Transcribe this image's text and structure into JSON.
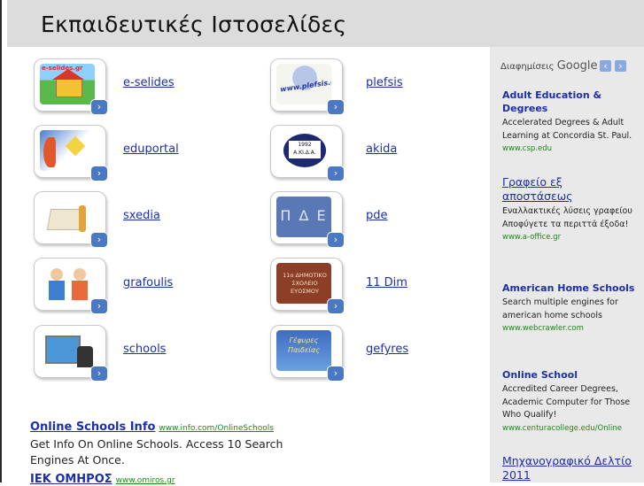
{
  "header": {
    "title": "Εκπαιδευτικές Ιστοσελίδες"
  },
  "sites": [
    {
      "label": "e-selides",
      "thumb_text": "e-selides.gr"
    },
    {
      "label": "plefsis",
      "thumb_text": "www.plefsis.gr"
    },
    {
      "label": "eduportal",
      "thumb_text": ""
    },
    {
      "label": "akida",
      "thumb_text": "1992 Α.ΚΙ.Δ.Α."
    },
    {
      "label": "sxedia",
      "thumb_text": ""
    },
    {
      "label": "pde",
      "thumb_text": "Π Δ Ε"
    },
    {
      "label": "grafoulis",
      "thumb_text": ""
    },
    {
      "label": "11 Dim",
      "thumb_text": "11ο ΔΗΜΟΤΙΚΟ ΣΧΟΛΕΙΟ ΕΥΟΣΜΟΥ"
    },
    {
      "label": "schools",
      "thumb_text": ""
    },
    {
      "label": "gefyres",
      "thumb_text": "Γέφυρες Παιδείας"
    }
  ],
  "main_ads": [
    {
      "title": "Online Schools Info",
      "url": "www.info.com/OnlineSchools",
      "desc": "Get Info On Online Schools. Access 10 Search Engines At Once."
    },
    {
      "title": "ΙΕΚ ΟΜΗΡΟΣ",
      "url": "www.omiros.gr",
      "desc": ""
    }
  ],
  "sidebar": {
    "ads_label": "Διαφημίσεις",
    "google_label": "Google",
    "prev_icon": "chevron-left-icon",
    "next_icon": "chevron-right-icon",
    "ads": [
      {
        "title": "Adult Education & Degrees",
        "desc": "Accelerated Degrees & Adult Learning at Concordia St. Paul.",
        "url": "www.csp.edu"
      },
      {
        "title": "Γραφείο εξ αποστάσεως",
        "desc": "Εναλλακτικές λύσεις γραφείου Αποφύγετε τα περιττά έξοδα!",
        "url": "www.a-office.gr"
      },
      {
        "title": "American Home Schools",
        "desc": "Search multiple engines for american home schools",
        "url": "www.webcrawler.com"
      },
      {
        "title": "Online School",
        "desc": "Accredited Career Degrees, Academic Computer for Those Who Qualify!",
        "url": "www.centuracollege.edu/Online"
      },
      {
        "title": "Μηχανογραφικό Δελτίο 2011",
        "desc": "",
        "url": ""
      }
    ]
  },
  "colors": {
    "link": "#1d2fa8",
    "url_green": "#1a8a1a",
    "header_bg": "#dcdcdc",
    "sidebar_bg": "#e9e9e9",
    "arrow_blue": "#4a78c2"
  }
}
